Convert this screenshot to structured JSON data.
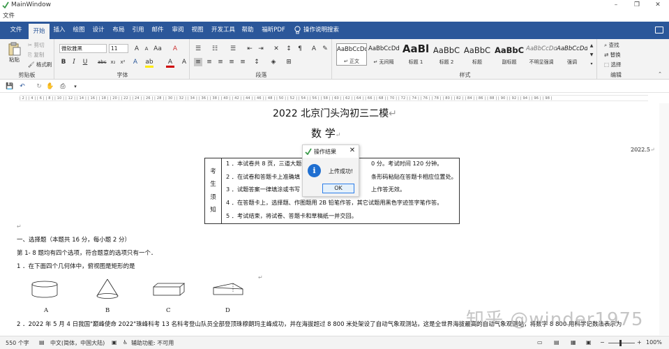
{
  "window": {
    "title": "MainWindow",
    "menu_file": "文件",
    "controls": [
      "–",
      "❐",
      "✕"
    ]
  },
  "tabs": [
    "文件",
    "开始",
    "插入",
    "绘图",
    "设计",
    "布局",
    "引用",
    "邮件",
    "审阅",
    "视图",
    "开发工具",
    "帮助",
    "福昕PDF"
  ],
  "active_tab": "开始",
  "tell_me": "操作说明搜索",
  "ribbon": {
    "clipboard": {
      "paste": "粘贴",
      "cut": "剪切",
      "copy": "复制",
      "format_painter": "格式刷",
      "label": "剪贴板"
    },
    "font": {
      "font_name": "微软雅黑",
      "font_size": "11",
      "label": "字体"
    },
    "paragraph": {
      "label": "段落"
    },
    "styles": {
      "label": "样式",
      "items": [
        {
          "preview": "AaBbCcDd",
          "name": "↵ 正文"
        },
        {
          "preview": "AaBbCcDd",
          "name": "↵ 无间隔"
        },
        {
          "preview": "AaBl",
          "name": "标题 1"
        },
        {
          "preview": "AaBbC",
          "name": "标题 2"
        },
        {
          "preview": "AaBbC",
          "name": "标题"
        },
        {
          "preview": "AaBbC",
          "name": "副标题"
        },
        {
          "preview": "AaBbCcDd",
          "name": "不明显强调"
        },
        {
          "preview": "AaBbCcDd",
          "name": "强调"
        }
      ]
    },
    "editing": {
      "find": "查找",
      "replace": "替换",
      "select": "选择",
      "label": "编辑"
    }
  },
  "ruler": "| 2 |   | 4 |   | 6 |   | 8 |   | 10 |   | 12 |   | 14 |   | 16 |   | 18 |   | 20 |   | 22 |   | 24 |   | 26 |   | 28 |   | 30 |   | 32 |   | 34 |   | 36 |   | 38 |   | 40 |   | 42 |   | 44 |   | 46 |   | 48 |   | 50 |   | 52 |   | 54 |   | 56 |   | 58 |   | 60 |   | 62 |   | 64 |   | 66 |   | 68 |   | 70 |   | 72 |   | 74 |   | 76 |   | 78 |   | 80 |   | 82 |   | 84 |   | 86 |   | 88 |   | 90 |   | 92 |   | 94 |   | 96 |   | 98 |",
  "document": {
    "title": "2022 北京门头沟初三二模",
    "subject": "数    学",
    "date": "2022.5",
    "notes_label": [
      "考",
      "生",
      "须",
      "知"
    ],
    "notes": [
      "1 ．本试卷共 8 页，三道大题",
      "0 分。考试时间 120 分钟。",
      "2 ．在试卷和答题卡上准确填",
      "条形码粘贴在答题卡相应位置处。",
      "3 ．试题答案一律填涂或书写",
      "上作答无效。",
      "4 ．在答题卡上，选择题、作图题用 2B 铅笔作答，其它试题用黑色字迹签字笔作答。",
      "5 ．考试结束，将试卷、答题卡和草稿纸一并交回。"
    ],
    "section1": "一、选择题（本题共 16 分，每小题 2 分）",
    "section1_desc": "第 1- 8 题均有四个选项，符合题意的选项只有一个．",
    "q1": "1 ．在下面四个几何体中，俯视图是矩形的是",
    "options": [
      "A",
      "B",
      "C",
      "D"
    ],
    "q2": "2 ．2022 年 5 月 4 日我国\"巅峰使命 2022\"珠峰科考 13 名科考登山队员全部登顶珠穆朗玛主峰成功，并在海拔超过 8 800 米处架设了自动气象观测站，这是全世界海拔最高的自动气象观测站，将数字 8 800 用科学记数法表示为"
  },
  "dialog": {
    "title": "操作结果",
    "message": "上传成功!",
    "ok": "OK"
  },
  "status": {
    "words": "550 个字",
    "language": "中文(简体，中国大陆)",
    "accessibility": "辅助功能: 不可用",
    "zoom": "100%"
  },
  "watermark": "知乎 @winder1975"
}
